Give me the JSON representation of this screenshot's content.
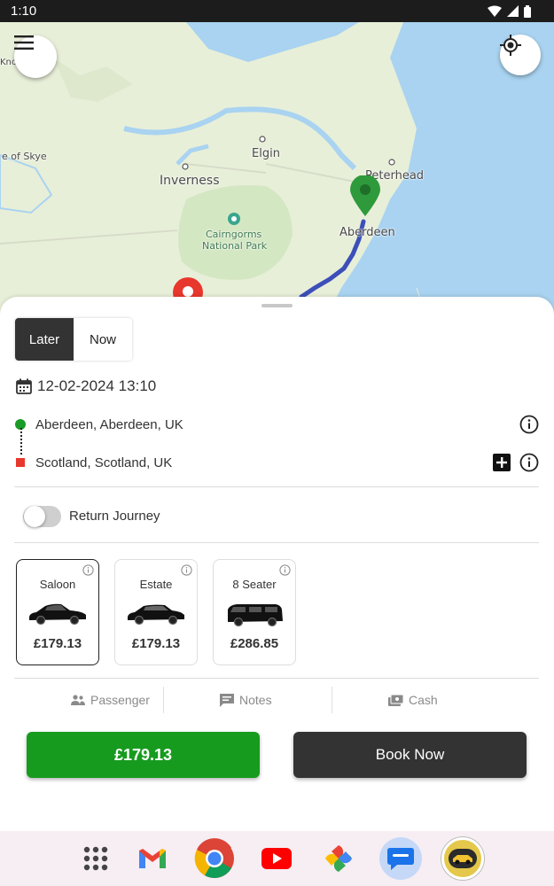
{
  "status_bar": {
    "time": "1:10"
  },
  "map": {
    "labels": {
      "skye": "e of Skye",
      "inverness": "Inverness",
      "elgin": "Elgin",
      "peterhead": "Peterhead",
      "aberdeen": "Aberdeen",
      "cairngorms": "Cairngorms",
      "national_park": "National Park",
      "knoy": "Knoy"
    },
    "colors": {
      "water": "#a9d3f0",
      "land": "#e8efd9",
      "route": "#3d4fb8",
      "pickup_pin": "#2e9a3c",
      "dropoff_pin": "#e8372c"
    }
  },
  "booking": {
    "tabs": [
      {
        "label": "Later",
        "active": true
      },
      {
        "label": "Now",
        "active": false
      }
    ],
    "datetime": "12-02-2024 13:10",
    "pickup": "Aberdeen, Aberdeen, UK",
    "dropoff": "Scotland, Scotland, UK",
    "return_journey": {
      "label": "Return Journey",
      "enabled": false
    },
    "vehicles": [
      {
        "name": "Saloon",
        "price": "£179.13",
        "selected": true
      },
      {
        "name": "Estate",
        "price": "£179.13",
        "selected": false
      },
      {
        "name": "8 Seater",
        "price": "£286.85",
        "selected": false
      }
    ],
    "options": {
      "passenger": "Passenger",
      "notes": "Notes",
      "payment": "Cash"
    },
    "price_button": "£179.13",
    "book_button": "Book Now"
  },
  "colors": {
    "accent_green": "#179b1e",
    "dark": "#333333"
  },
  "taskbar": {
    "apps": [
      "apps-grid-icon",
      "gmail-icon",
      "chrome-icon",
      "youtube-icon",
      "photos-icon",
      "messages-icon",
      "taxi-app-icon"
    ]
  }
}
